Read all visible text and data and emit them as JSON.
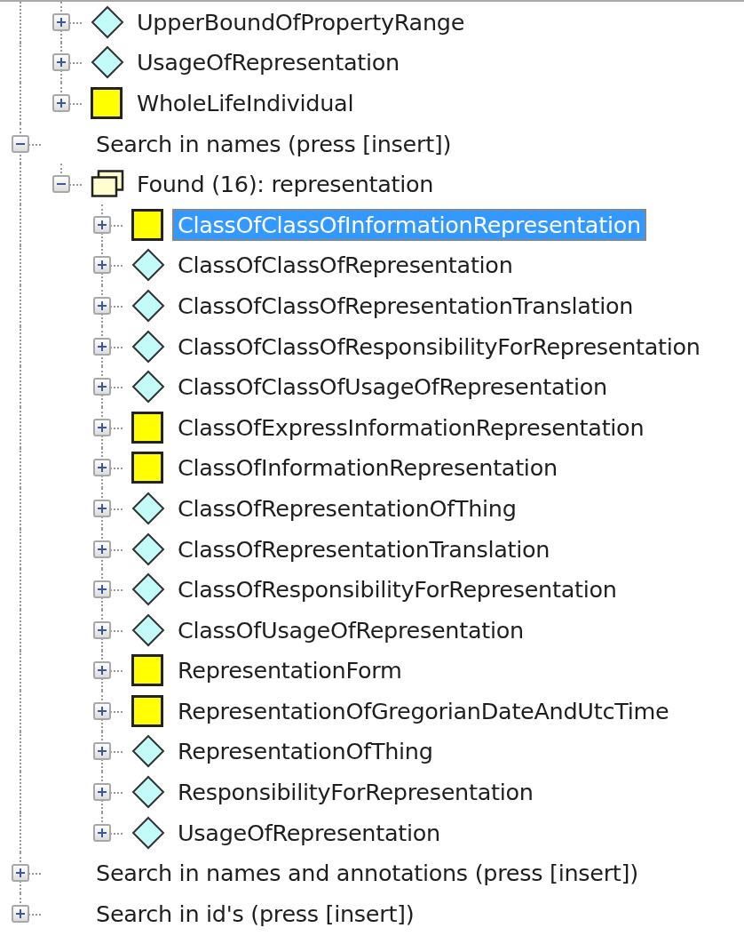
{
  "tree": [
    {
      "children": [
        {
          "label": "UpperBoundOfPropertyRange",
          "kind": "diamond",
          "expanded": false
        },
        {
          "label": "UsageOfRepresentation",
          "kind": "diamond",
          "expanded": false
        },
        {
          "label": "WholeLifeIndividual",
          "kind": "square",
          "expanded": false
        }
      ]
    },
    {
      "label": "Search in names (press [insert])",
      "expanded": true,
      "children": [
        {
          "label": "Found (16): representation",
          "kind": "folder",
          "expanded": true,
          "children": [
            {
              "label": "ClassOfClassOfInformationRepresentation",
              "kind": "square",
              "expanded": false,
              "selected": true
            },
            {
              "label": "ClassOfClassOfRepresentation",
              "kind": "diamond",
              "expanded": false,
              "selected": false
            },
            {
              "label": "ClassOfClassOfRepresentationTranslation",
              "kind": "diamond",
              "expanded": false,
              "selected": false
            },
            {
              "label": "ClassOfClassOfResponsibilityForRepresentation",
              "kind": "diamond",
              "expanded": false,
              "selected": false
            },
            {
              "label": "ClassOfClassOfUsageOfRepresentation",
              "kind": "diamond",
              "expanded": false,
              "selected": false
            },
            {
              "label": "ClassOfExpressInformationRepresentation",
              "kind": "square",
              "expanded": false,
              "selected": false
            },
            {
              "label": "ClassOfInformationRepresentation",
              "kind": "square",
              "expanded": false,
              "selected": false
            },
            {
              "label": "ClassOfRepresentationOfThing",
              "kind": "diamond",
              "expanded": false,
              "selected": false
            },
            {
              "label": "ClassOfRepresentationTranslation",
              "kind": "diamond",
              "expanded": false,
              "selected": false
            },
            {
              "label": "ClassOfResponsibilityForRepresentation",
              "kind": "diamond",
              "expanded": false,
              "selected": false
            },
            {
              "label": "ClassOfUsageOfRepresentation",
              "kind": "diamond",
              "expanded": false,
              "selected": false
            },
            {
              "label": "RepresentationForm",
              "kind": "square",
              "expanded": false,
              "selected": false
            },
            {
              "label": "RepresentationOfGregorianDateAndUtcTime",
              "kind": "square",
              "expanded": false,
              "selected": false
            },
            {
              "label": "RepresentationOfThing",
              "kind": "diamond",
              "expanded": false,
              "selected": false
            },
            {
              "label": "ResponsibilityForRepresentation",
              "kind": "diamond",
              "expanded": false,
              "selected": false
            },
            {
              "label": "UsageOfRepresentation",
              "kind": "diamond",
              "expanded": false,
              "selected": false
            }
          ]
        }
      ]
    },
    {
      "label": "Search in names and annotations (press [insert])",
      "expanded": false
    },
    {
      "label": "Search in id's (press [insert])",
      "expanded": false
    }
  ]
}
